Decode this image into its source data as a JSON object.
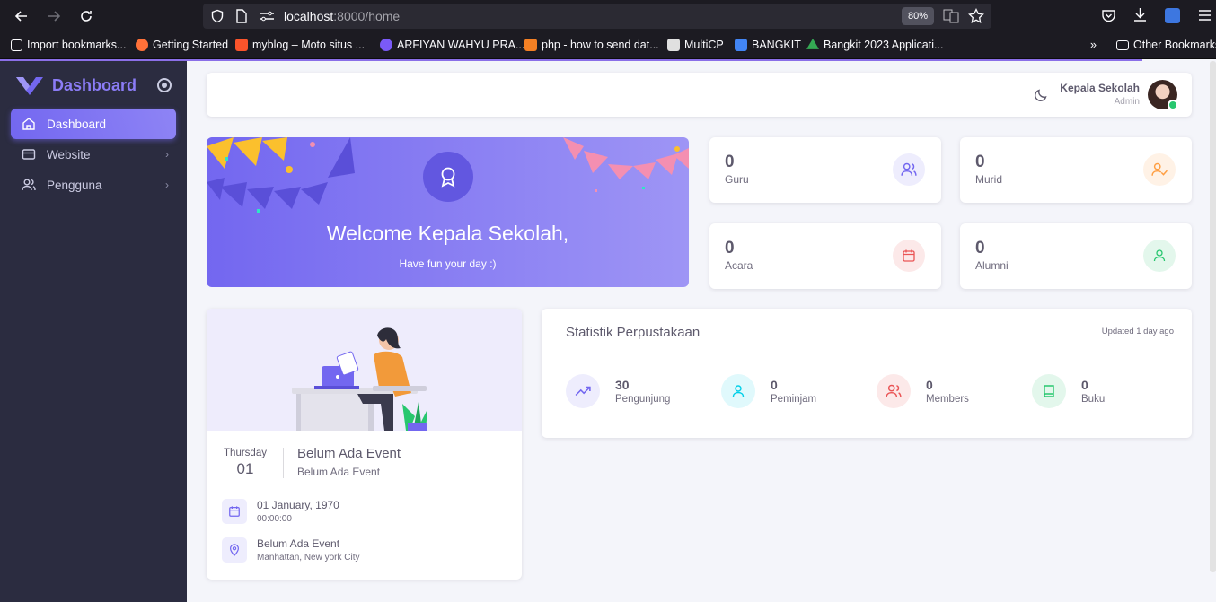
{
  "browser": {
    "url_host": "localhost",
    "url_path": ":8000/home",
    "zoom": "80%",
    "bookmarks": [
      {
        "label": "Import bookmarks...",
        "color": "#fbfbfe"
      },
      {
        "label": "Getting Started",
        "color": "#ff7139"
      },
      {
        "label": "myblog – Moto situs ...",
        "color": "#fb542b"
      },
      {
        "label": "ARFIYAN WAHYU PRA...",
        "color": "#7a5af8"
      },
      {
        "label": "php - how to send dat...",
        "color": "#f48024"
      },
      {
        "label": "MultiCP",
        "color": "#e0e0e0"
      },
      {
        "label": "BANGKIT",
        "color": "#4285f4"
      },
      {
        "label": "Bangkit 2023 Applicati...",
        "color": "#34a853"
      }
    ],
    "other_bookmarks": "Other Bookmarks"
  },
  "sidebar": {
    "brand": "Dashboard",
    "items": [
      {
        "label": "Dashboard",
        "icon": "home-icon",
        "active": true
      },
      {
        "label": "Website",
        "icon": "window-icon",
        "active": false
      },
      {
        "label": "Pengguna",
        "icon": "users-icon",
        "active": false
      }
    ]
  },
  "navbar": {
    "user_name": "Kepala Sekolah",
    "user_role": "Admin"
  },
  "welcome": {
    "title": "Welcome Kepala Sekolah,",
    "subtitle": "Have fun your day :)"
  },
  "stats": [
    {
      "value": "0",
      "label": "Guru",
      "icon": "users-icon",
      "color": "#7367f0",
      "bg": "#eeedfd"
    },
    {
      "value": "0",
      "label": "Murid",
      "icon": "user-check-icon",
      "color": "#ff9f43",
      "bg": "#fff2e6"
    },
    {
      "value": "0",
      "label": "Acara",
      "icon": "calendar-icon",
      "color": "#ea5455",
      "bg": "#fce9e9"
    },
    {
      "value": "0",
      "label": "Alumni",
      "icon": "user-icon",
      "color": "#28c76f",
      "bg": "#e3f7ec"
    }
  ],
  "event": {
    "day_name": "Thursday",
    "day_num": "01",
    "title": "Belum Ada Event",
    "subtitle": "Belum Ada Event",
    "date": "01 January, 1970",
    "time": "00:00:00",
    "place": "Belum Ada Event",
    "address": "Manhattan, New york City"
  },
  "library": {
    "title": "Statistik Perpustakaan",
    "updated": "Updated 1 day ago",
    "items": [
      {
        "value": "30",
        "label": "Pengunjung",
        "icon": "trending-up-icon",
        "color": "#7367f0",
        "bg": "#eeedfd"
      },
      {
        "value": "0",
        "label": "Peminjam",
        "icon": "user-icon",
        "color": "#00cfe8",
        "bg": "#e0f9fc"
      },
      {
        "value": "0",
        "label": "Members",
        "icon": "users-icon",
        "color": "#ea5455",
        "bg": "#fce9e9"
      },
      {
        "value": "0",
        "label": "Buku",
        "icon": "book-icon",
        "color": "#28c76f",
        "bg": "#e3f7ec"
      }
    ]
  }
}
